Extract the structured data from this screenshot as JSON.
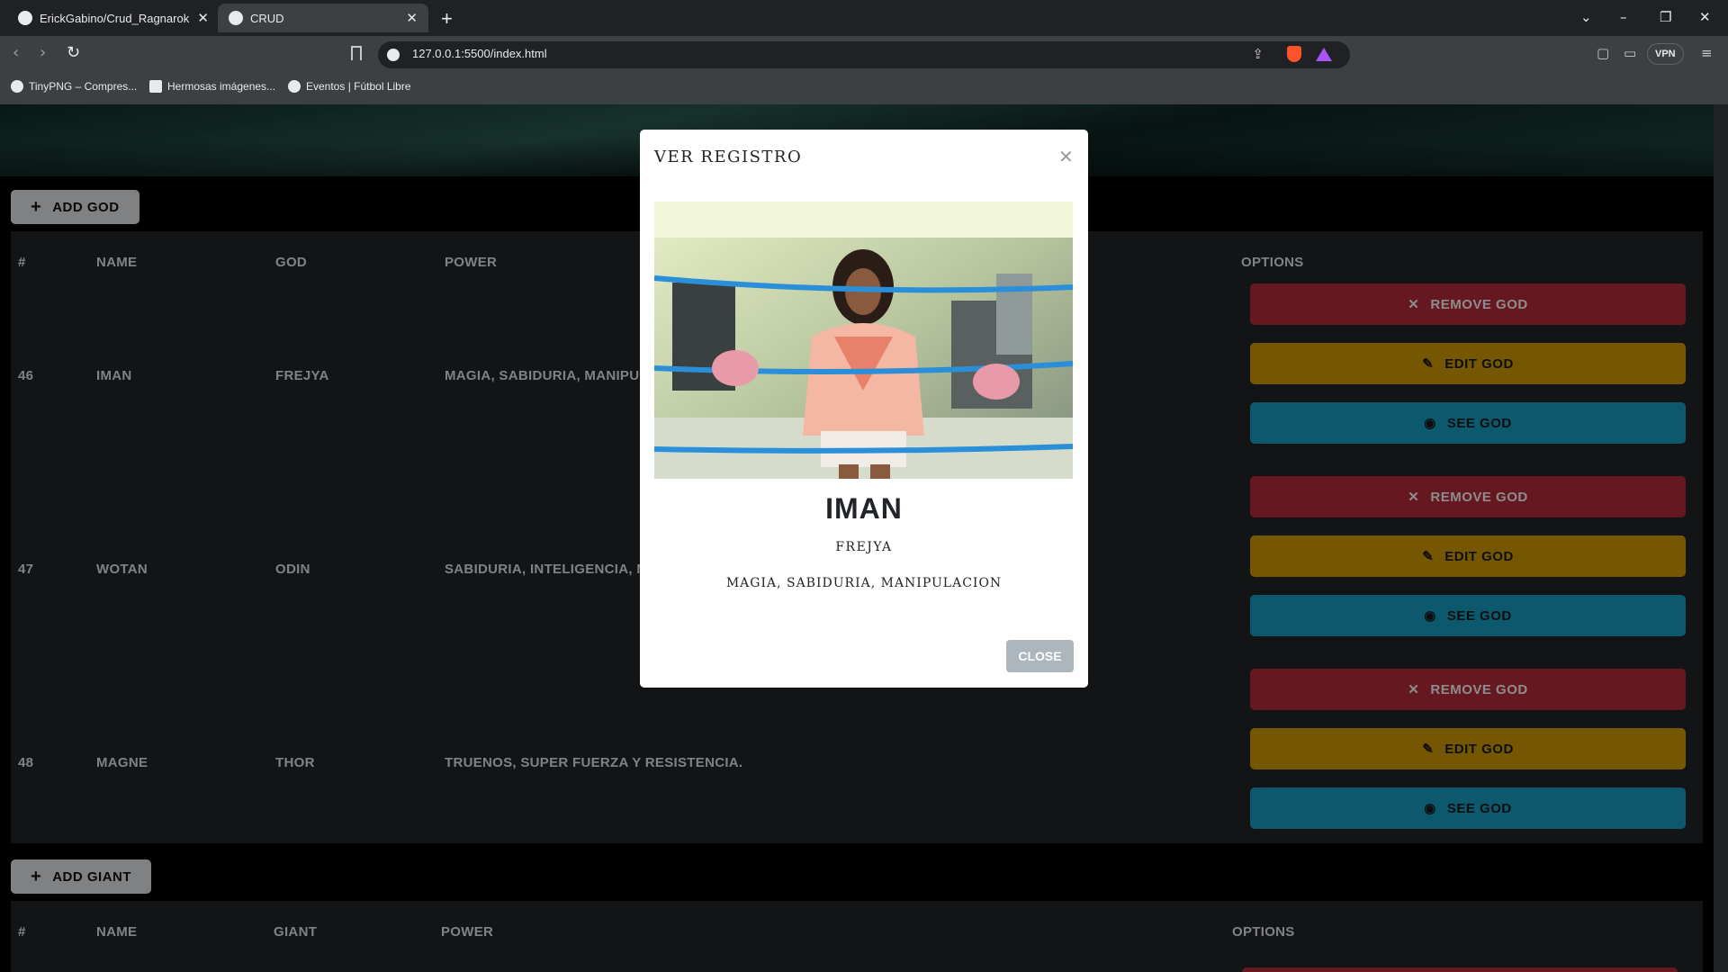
{
  "browser": {
    "tabs": [
      {
        "label": "ErickGabino/Crud_Ragnarok: This is"
      },
      {
        "label": "CRUD"
      }
    ],
    "url": "127.0.0.1:5500/index.html",
    "vpn_label": "VPN",
    "bookmarks": [
      {
        "label": "TinyPNG – Compres..."
      },
      {
        "label": "Hermosas imágenes..."
      },
      {
        "label": "Eventos | Fútbol Libre"
      }
    ]
  },
  "gods_section": {
    "add_label": "ADD GOD",
    "headers": [
      "#",
      "NAME",
      "GOD",
      "POWER",
      "OPTIONS"
    ],
    "rows": [
      {
        "id": "46",
        "name": "IMAN",
        "god": "FREJYA",
        "power": "MAGIA, SABIDURIA, MANIPULACION"
      },
      {
        "id": "47",
        "name": "WOTAN",
        "god": "ODIN",
        "power": "SABIDURIA, INTELIGENCIA, MAGIA"
      },
      {
        "id": "48",
        "name": "MAGNE",
        "god": "THOR",
        "power": "TRUENOS, SUPER FUERZA Y RESISTENCIA."
      }
    ],
    "buttons": {
      "remove": "REMOVE GOD",
      "edit": "EDIT GOD",
      "see": "SEE GOD"
    }
  },
  "giants_section": {
    "add_label": "ADD GIANT",
    "headers": [
      "#",
      "NAME",
      "GIANT",
      "POWER",
      "OPTIONS"
    ]
  },
  "modal": {
    "title": "VER REGISTRO",
    "name": "IMAN",
    "god": "FREJYA",
    "power": "MAGIA, SABIDURIA, MANIPULACION",
    "close_label": "CLOSE"
  },
  "colors": {
    "remove": "#bb2d3b",
    "edit": "#d39e00",
    "see": "#17a2c7",
    "table_bg": "#212529"
  }
}
